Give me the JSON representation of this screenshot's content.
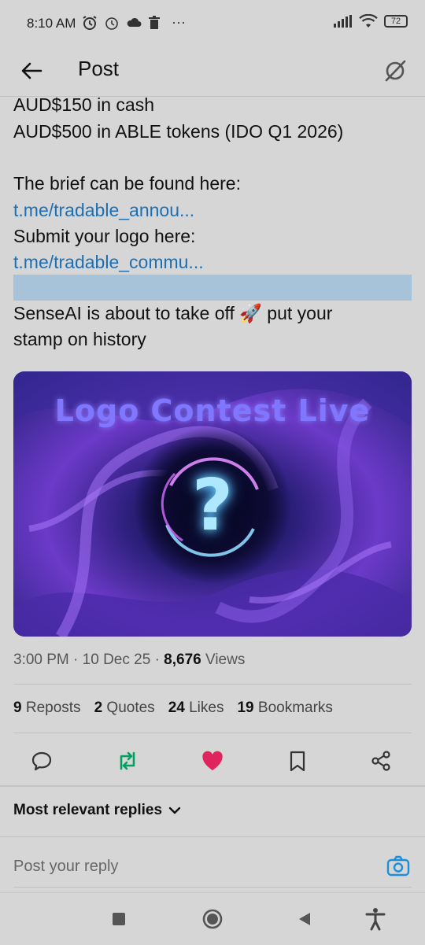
{
  "status_bar": {
    "time": "8:10 AM",
    "left_icons": [
      "alarm-icon",
      "alarm-icon",
      "cloud-icon",
      "trash-icon",
      "more-icon"
    ],
    "more_glyph": "···",
    "battery_level": "72"
  },
  "header": {
    "title": "Post"
  },
  "post": {
    "lines": {
      "prize_cash": "AUD$150 in cash",
      "prize_tokens": "AUD$500 in ABLE tokens (IDO Q1 2026)",
      "brief_label": "The brief can be found here:",
      "brief_link": "t.me/tradable_annou...",
      "submit_label": "Submit your logo here:",
      "submit_link": "t.me/tradable_commu...",
      "closing_line1": "SenseAI is about to take off 🚀 put your",
      "closing_line2": "stamp on history"
    },
    "image_title": "Logo Contest Live",
    "image_glyph": "?",
    "meta": {
      "time": "3:00 PM",
      "separator": "·",
      "date": "10 Dec 25",
      "views_count": "8,676",
      "views_label": "Views"
    },
    "stats": {
      "reposts_count": "9",
      "reposts_label": "Reposts",
      "quotes_count": "2",
      "quotes_label": "Quotes",
      "likes_count": "24",
      "likes_label": "Likes",
      "bookmarks_count": "19",
      "bookmarks_label": "Bookmarks"
    },
    "colors": {
      "link": "#1d6fb3",
      "repost_active": "#00a060",
      "like_active": "#e0245e"
    }
  },
  "replies": {
    "sort_label": "Most relevant replies",
    "reply_placeholder": "Post your reply"
  }
}
